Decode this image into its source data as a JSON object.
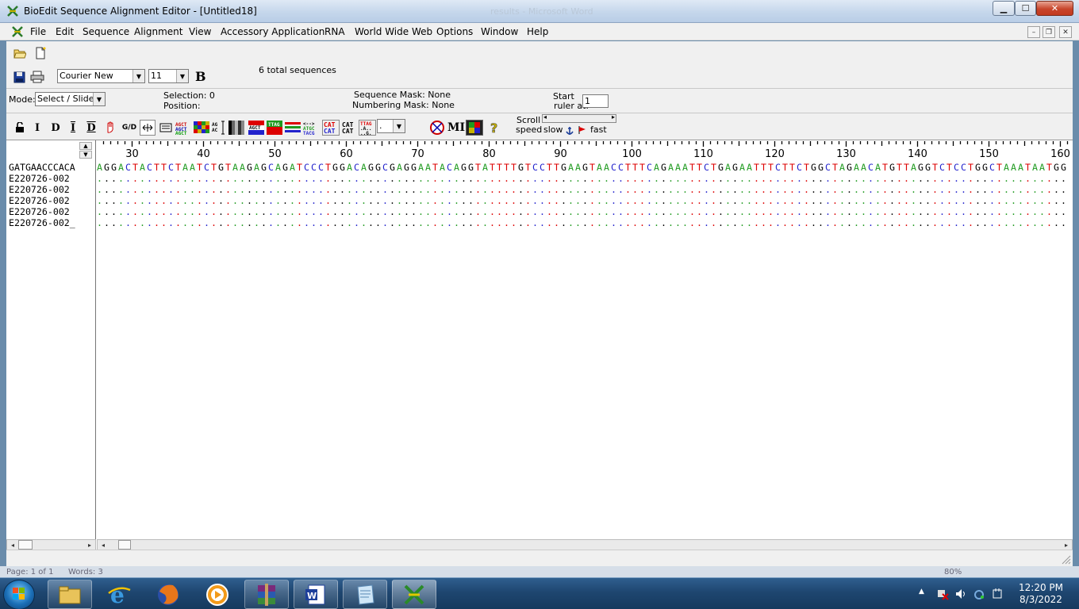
{
  "window": {
    "title": "BioEdit Sequence Alignment Editor - [Untitled18]",
    "background_title": "results - Microsoft Word",
    "controls": {
      "minimize": "▁",
      "maximize": "☐",
      "close": "✕"
    }
  },
  "menubar": {
    "items": [
      "File",
      "Edit",
      "Sequence",
      "Alignment",
      "View",
      "Accessory Application",
      "RNA",
      "World Wide Web",
      "Options",
      "Window",
      "Help"
    ],
    "mdi": {
      "minimize": "–",
      "restore": "❐",
      "close": "✕"
    }
  },
  "toolbar": {
    "font_name": "Courier New",
    "font_size": "11",
    "bold_label": "B",
    "total_sequences": "6 total sequences",
    "mode_label": "Mode:",
    "mode_value": "Select / Slide",
    "selection_label": "Selection: 0",
    "position_label": "Position:",
    "sequence_mask": "Sequence Mask: None",
    "numbering_mask": "Numbering Mask: None",
    "start_ruler_label_1": "Start",
    "start_ruler_label_2": "ruler at:",
    "start_ruler_value": "1",
    "scroll_label": "Scroll",
    "speed_label": "speed",
    "slow_label": "slow",
    "fast_label": "fast",
    "tools": [
      "I",
      "D",
      "I",
      "D",
      "G/D",
      "MI"
    ],
    "combo_value": "."
  },
  "ruler": {
    "labels": [
      "30",
      "40",
      "50",
      "60",
      "70",
      "80",
      "90",
      "100",
      "110",
      "120",
      "130",
      "140",
      "150",
      "160"
    ]
  },
  "sequences": {
    "names": [
      "GATGAACCCACA",
      "E220726-002",
      "E220726-002",
      "E220726-002",
      "E220726-002",
      "E220726-002_"
    ],
    "reference": "AGGACTACTTCTAATCTGTAAGAGCAGATCCCTGGACAGGCGAGGAATACAGGTATTTTGTCCTTGAAGTAACCTTTCAGAAATTCTGAGAATTTCTTCTGGCTAGAACATGTTAGGTCTCCTGGCTAAATAATGG",
    "identity_rows": 5
  },
  "colors": {
    "A": "#1f9a1f",
    "C": "#2222cc",
    "G": "#000000",
    "T": "#dd0000"
  },
  "bg_window": {
    "page": "Page: 1 of 1",
    "words": "Words: 3",
    "zoom": "80%"
  },
  "taskbar": {
    "apps": [
      "file-explorer-icon",
      "internet-explorer-icon",
      "firefox-icon",
      "media-player-icon",
      "winrar-icon",
      "word-icon",
      "notepad-icon",
      "bioedit-icon"
    ],
    "time": "12:20 PM",
    "date": "8/3/2022"
  }
}
